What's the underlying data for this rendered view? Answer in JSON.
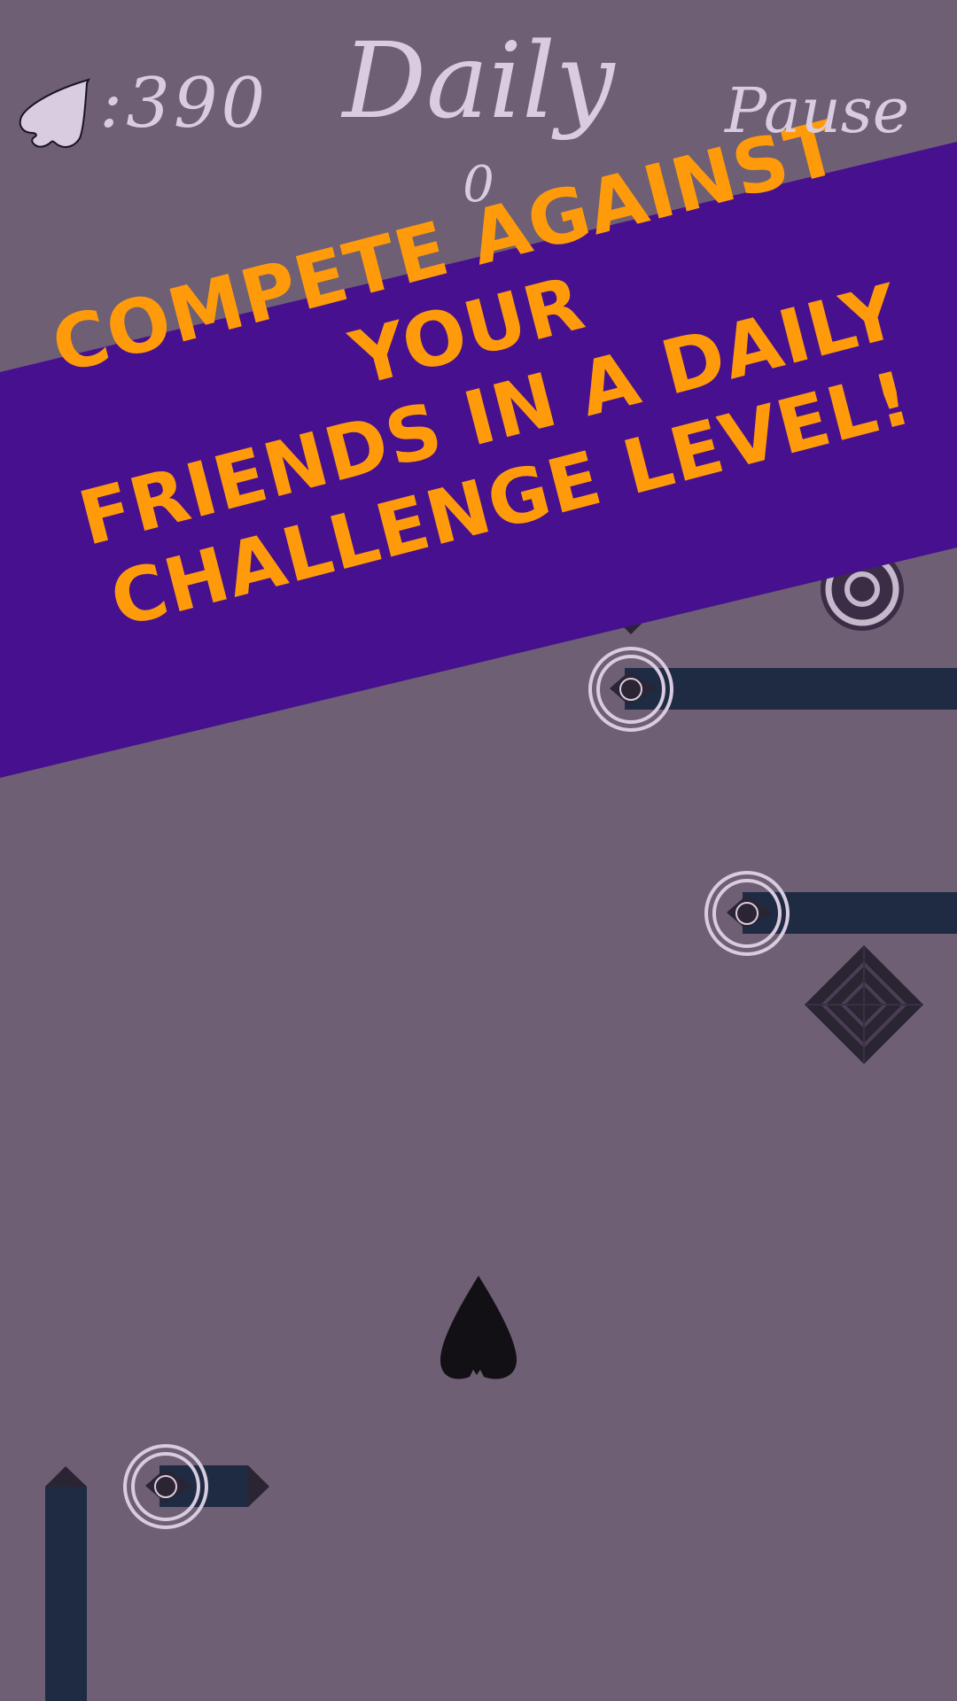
{
  "hud": {
    "coin_count": ":390",
    "mode_title": "Daily",
    "score": "0",
    "pause_label": "Pause"
  },
  "banner": {
    "lines": [
      "COMPETE AGAINST YOUR",
      "FRIENDS IN A DAILY",
      "CHALLENGE LEVEL!"
    ]
  },
  "colors": {
    "background": "#6e5f74",
    "banner": "#47108f",
    "banner_text": "#ff9b0b",
    "hud_text": "#d9cbe0",
    "bar": "#1e2b43",
    "player": "#120f15"
  },
  "icons": {
    "coin": "spade-icon",
    "player": "spade-player-icon",
    "target": "ring-target-icon",
    "obstacle": "diamond-obstacle-icon"
  }
}
